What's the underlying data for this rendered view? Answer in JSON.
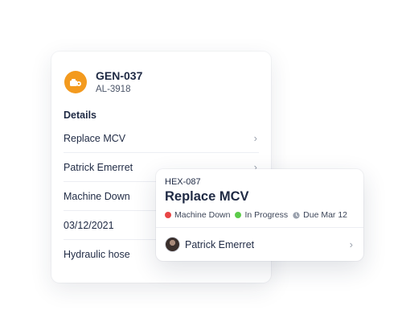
{
  "back_card": {
    "id": "GEN-037",
    "subtitle": "AL-3918",
    "details_label": "Details",
    "details": [
      {
        "text": "Replace MCV",
        "chevron": true
      },
      {
        "text": "Patrick Emerret",
        "chevron": true
      },
      {
        "text": "Machine Down",
        "chevron": false
      },
      {
        "text": "03/12/2021",
        "chevron": false
      },
      {
        "text": "Hydraulic hose",
        "chevron": false
      }
    ],
    "icon": "work-order-icon",
    "accent": "#f39a1e"
  },
  "front_card": {
    "id": "HEX-087",
    "title": "Replace MCV",
    "statuses": [
      {
        "label": "Machine Down",
        "color": "#e84545",
        "icon": "dot"
      },
      {
        "label": "In Progress",
        "color": "#5ccb4a",
        "icon": "dot"
      },
      {
        "label": "Due Mar 12",
        "color": "#9aa1ad",
        "icon": "clock-icon"
      }
    ],
    "assignee": "Patrick Emerret",
    "assignee_icon": "avatar"
  }
}
